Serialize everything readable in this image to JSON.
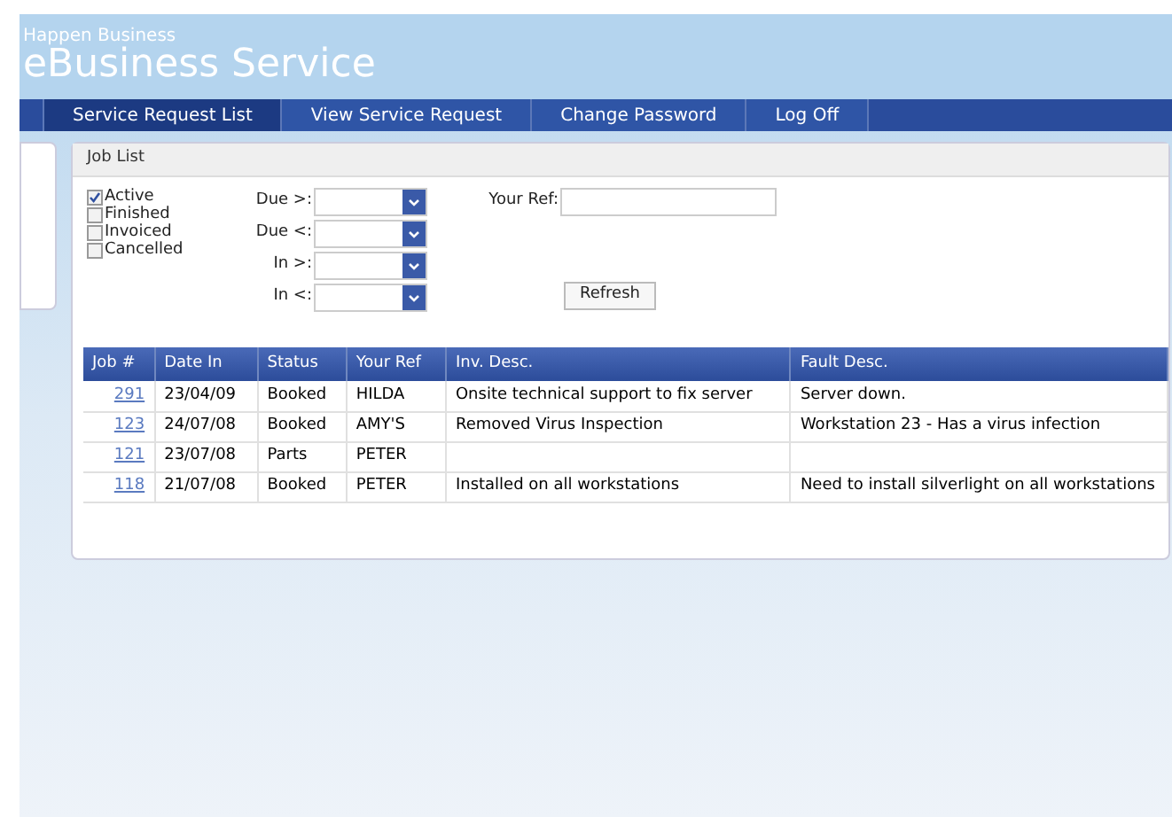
{
  "header": {
    "subtitle": "Happen Business",
    "title": "eBusiness Service"
  },
  "nav": [
    {
      "label": "Service Request List",
      "selected": true
    },
    {
      "label": "View Service Request",
      "selected": false
    },
    {
      "label": "Change Password",
      "selected": false
    },
    {
      "label": "Log Off",
      "selected": false
    }
  ],
  "panel": {
    "title": "Job List"
  },
  "statuses": [
    {
      "label": "Active",
      "checked": true
    },
    {
      "label": "Finished",
      "checked": false
    },
    {
      "label": "Invoiced",
      "checked": false
    },
    {
      "label": "Cancelled",
      "checked": false
    }
  ],
  "date_filters": [
    {
      "label": "Due >:"
    },
    {
      "label": "Due <:"
    },
    {
      "label": "In >:"
    },
    {
      "label": "In <:"
    }
  ],
  "your_ref": {
    "label": "Your Ref:"
  },
  "refresh_button": "Refresh",
  "table": {
    "columns": [
      "Job #",
      "Date In",
      "Status",
      "Your Ref",
      "Inv. Desc.",
      "Fault Desc."
    ],
    "rows": [
      [
        "291",
        "23/04/09",
        "Booked",
        "HILDA",
        "Onsite technical support to fix server",
        "Server down."
      ],
      [
        "123",
        "24/07/08",
        "Booked",
        "AMY'S",
        "Removed Virus Inspection",
        "Workstation 23 - Has a virus infection"
      ],
      [
        "121",
        "23/07/08",
        "Parts",
        "PETER",
        "",
        ""
      ],
      [
        "118",
        "21/07/08",
        "Booked",
        "PETER",
        "Installed on all workstations",
        "Need to install silverlight on all workstations"
      ]
    ]
  }
}
